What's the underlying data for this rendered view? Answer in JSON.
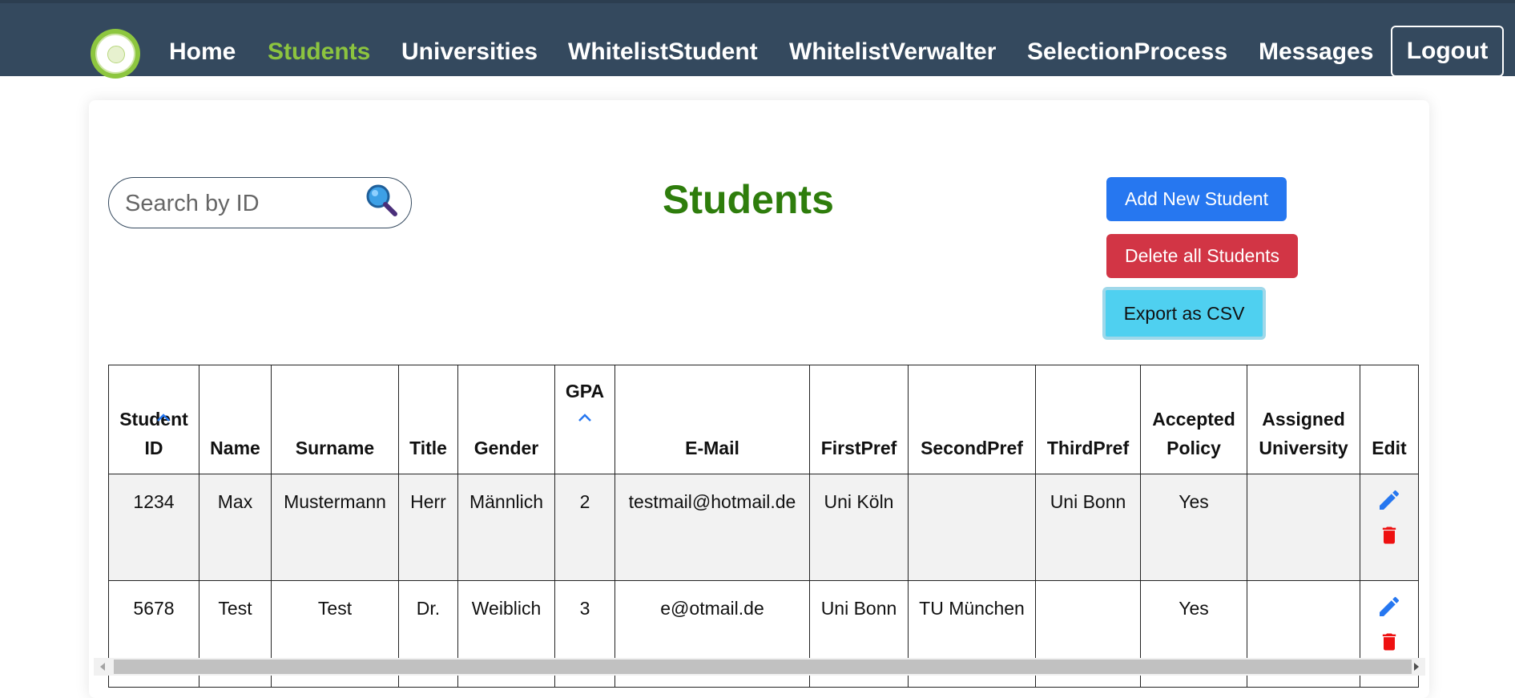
{
  "nav": {
    "items": [
      {
        "label": "Home",
        "active": false
      },
      {
        "label": "Students",
        "active": true
      },
      {
        "label": "Universities",
        "active": false
      },
      {
        "label": "WhitelistStudent",
        "active": false
      },
      {
        "label": "WhitelistVerwalter",
        "active": false
      },
      {
        "label": "SelectionProcess",
        "active": false
      },
      {
        "label": "Messages",
        "active": false
      }
    ],
    "logout_label": "Logout"
  },
  "search": {
    "placeholder": "Search by ID",
    "value": "",
    "icon": "search-icon"
  },
  "page_title": "Students",
  "actions": {
    "add_label": "Add New Student",
    "delete_all_label": "Delete all Students",
    "export_label": "Export as CSV"
  },
  "table": {
    "headers": [
      {
        "label": "Student ID",
        "sortable": true
      },
      {
        "label": "Name"
      },
      {
        "label": "Surname"
      },
      {
        "label": "Title"
      },
      {
        "label": "Gender"
      },
      {
        "label": "GPA",
        "sortable": true
      },
      {
        "label": "E-Mail"
      },
      {
        "label": "FirstPref"
      },
      {
        "label": "SecondPref"
      },
      {
        "label": "ThirdPref"
      },
      {
        "label": "Accepted Policy"
      },
      {
        "label": "Assigned University"
      },
      {
        "label": "Edit"
      }
    ],
    "rows": [
      {
        "student_id": "1234",
        "name": "Max",
        "surname": "Mustermann",
        "title": "Herr",
        "gender": "Männlich",
        "gpa": "2",
        "email": "testmail@hotmail.de",
        "first_pref": "Uni Köln",
        "second_pref": "",
        "third_pref": "Uni Bonn",
        "accepted_policy": "Yes",
        "assigned_university": ""
      },
      {
        "student_id": "5678",
        "name": "Test",
        "surname": "Test",
        "title": "Dr.",
        "gender": "Weiblich",
        "gpa": "3",
        "email": "e@otmail.de",
        "first_pref": "Uni Bonn",
        "second_pref": "TU München",
        "third_pref": "",
        "accepted_policy": "Yes",
        "assigned_university": ""
      }
    ]
  },
  "colors": {
    "navbar": "#34495e",
    "nav_active": "#8cc43f",
    "title": "#2e7d0c",
    "primary": "#2677f0",
    "danger": "#d23545",
    "info": "#4fd0f0",
    "edit_icon": "#2677f0",
    "delete_icon": "#ee1111"
  }
}
